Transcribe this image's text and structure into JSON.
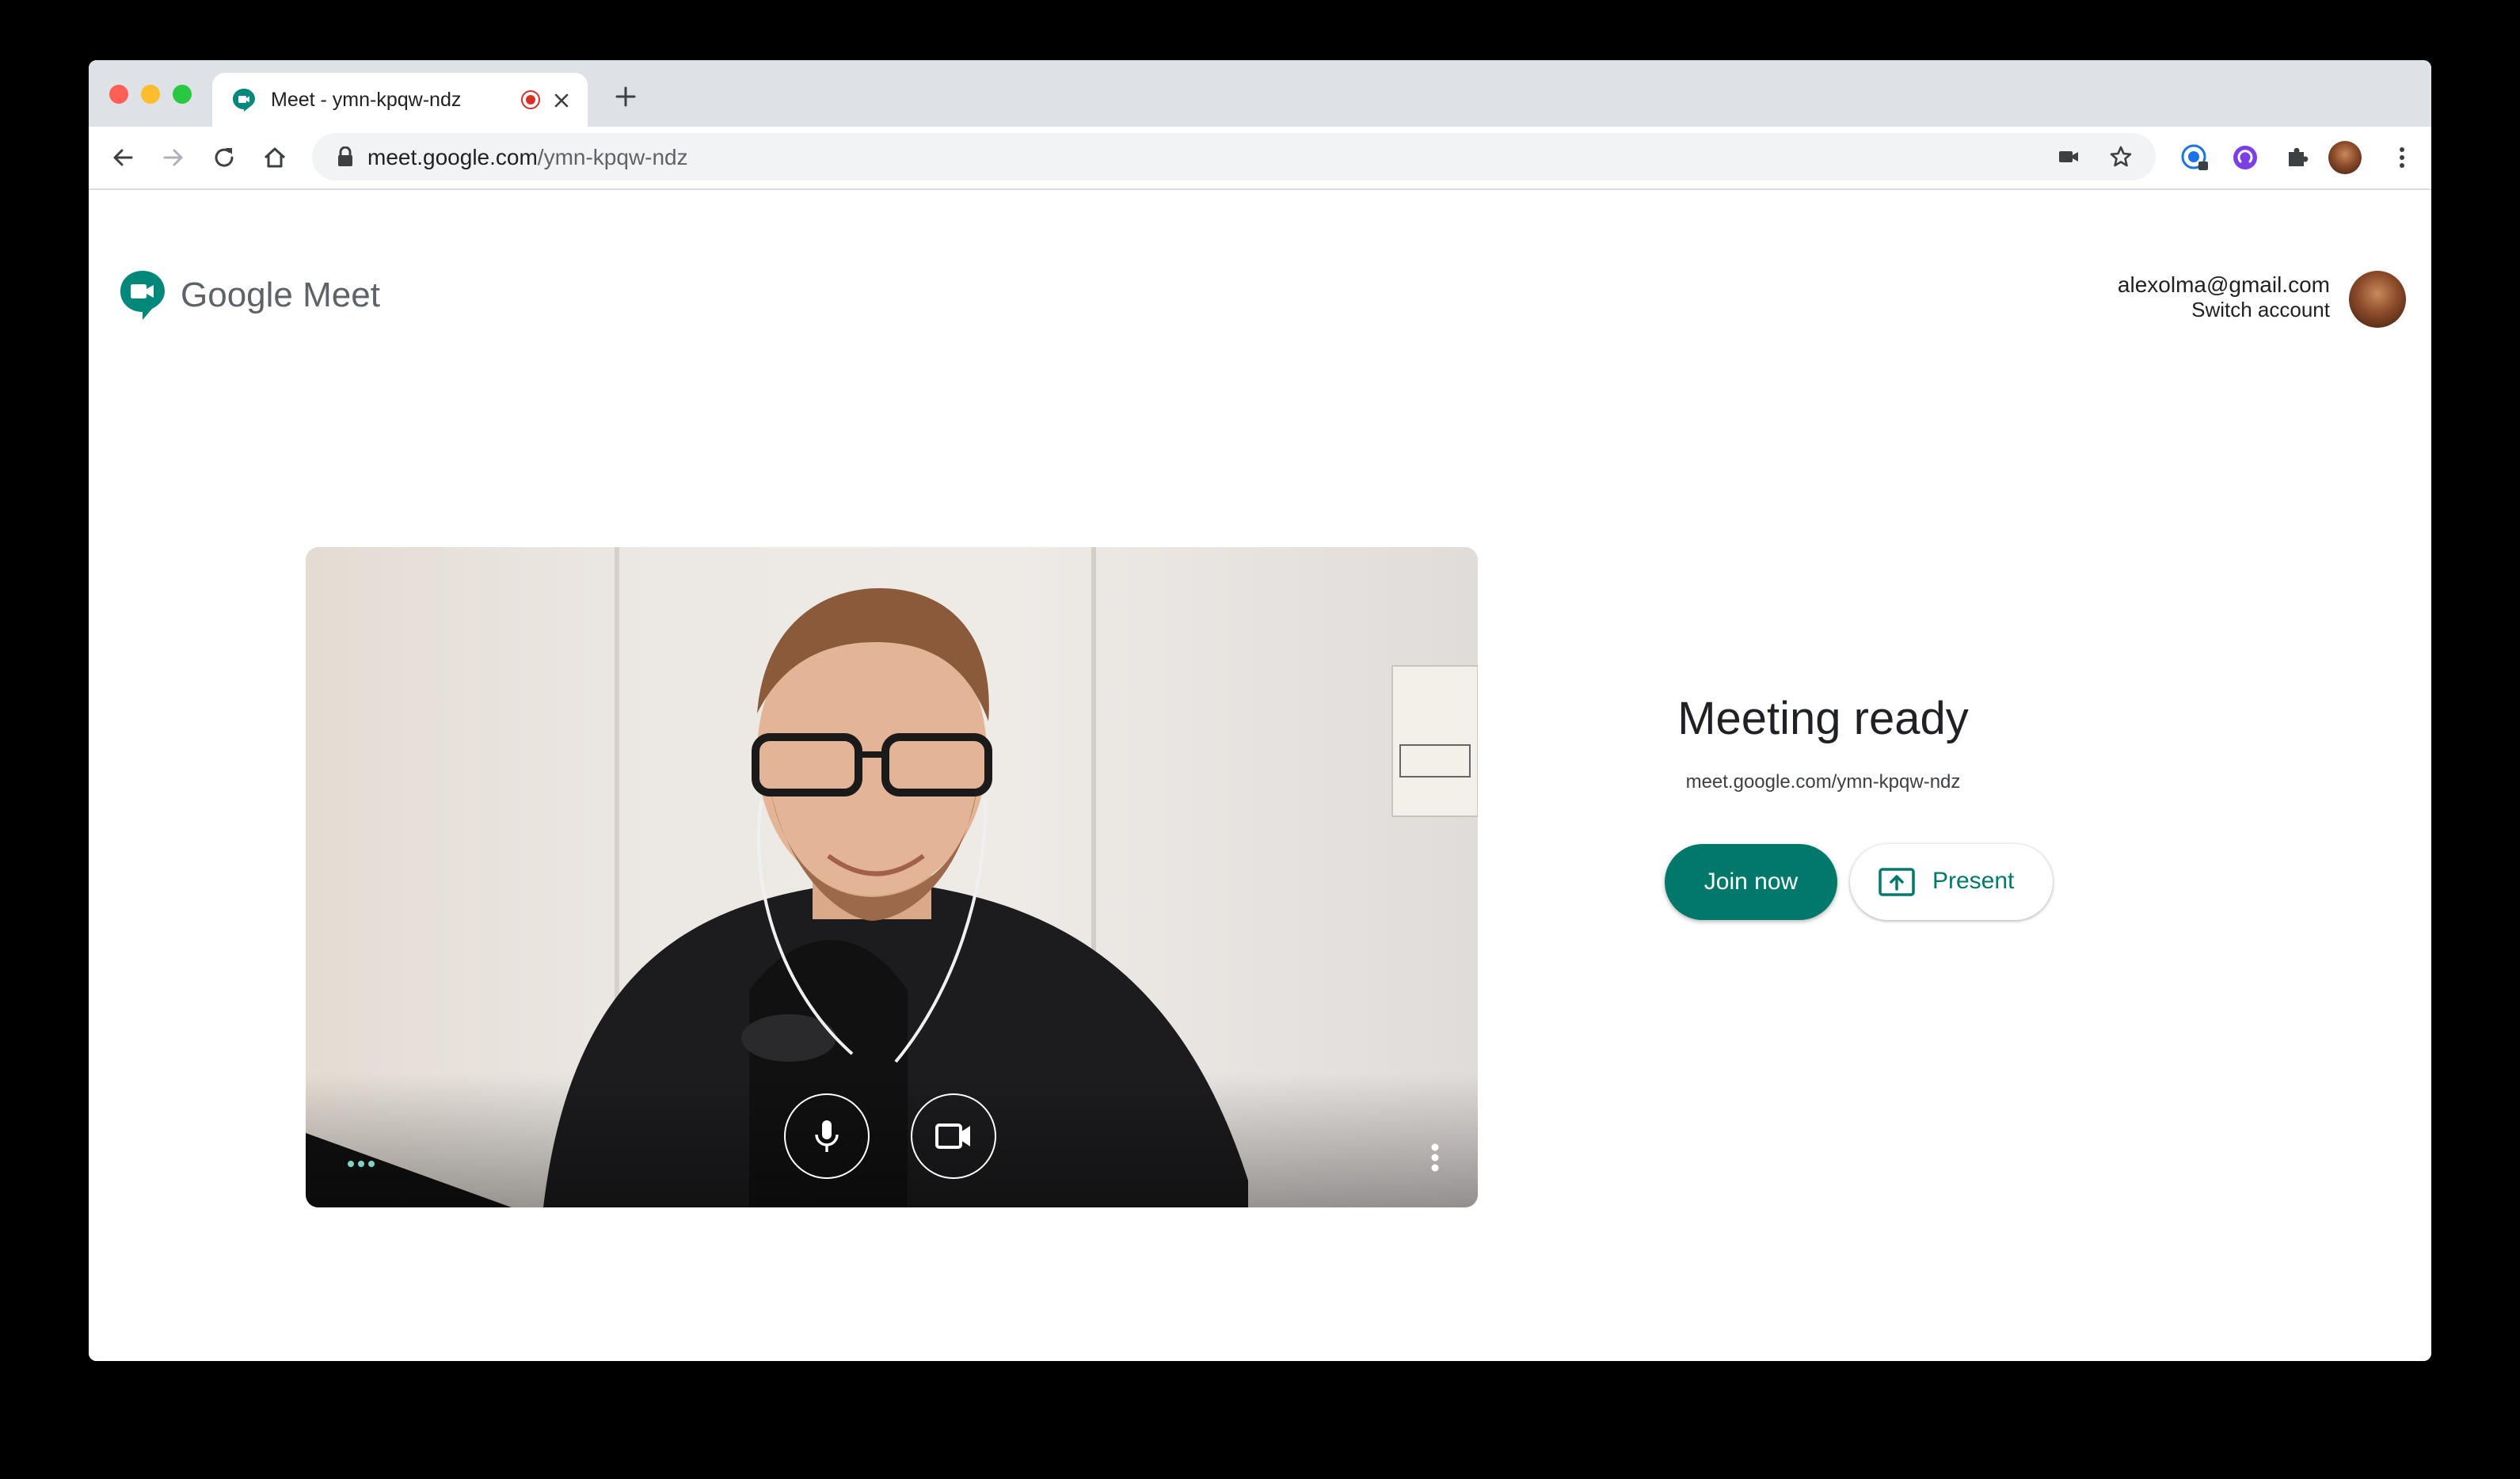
{
  "browser": {
    "tab_title": "Meet - ymn-kpqw-ndz",
    "url_host": "meet.google.com",
    "url_path": "/ymn-kpqw-ndz"
  },
  "header": {
    "logo_text": "Google Meet",
    "account_email": "alexolma@gmail.com",
    "switch_account": "Switch account"
  },
  "meeting": {
    "title": "Meeting ready",
    "link": "meet.google.com/ymn-kpqw-ndz",
    "join_label": "Join now",
    "present_label": "Present"
  },
  "colors": {
    "accent": "#00796b",
    "recording": "#d93025"
  },
  "icons": {
    "tab": [
      "meet-favicon",
      "recording-icon",
      "close-icon",
      "new-tab-icon"
    ],
    "toolbar": [
      "back-icon",
      "forward-icon",
      "reload-icon",
      "home-icon",
      "lock-icon",
      "camera-icon",
      "star-icon",
      "extension-icon",
      "puzzle-icon",
      "profile-avatar",
      "kebab-menu-icon"
    ],
    "preview": [
      "microphone-icon",
      "video-camera-icon",
      "more-options-icon"
    ]
  }
}
